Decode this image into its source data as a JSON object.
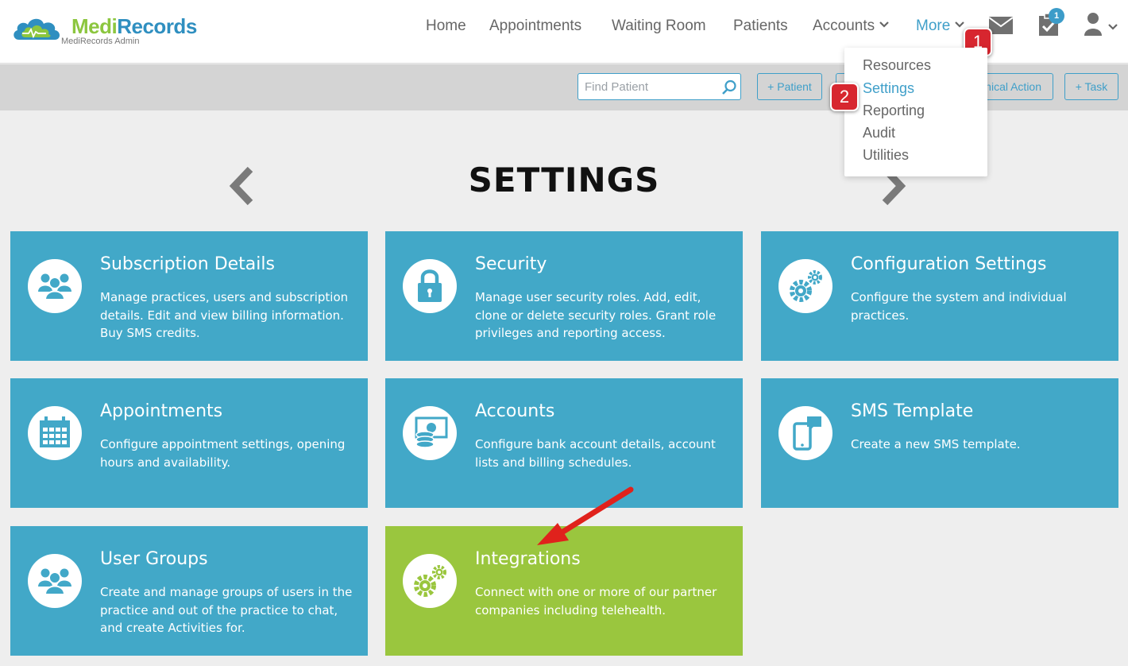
{
  "brand": {
    "name_part1": "Medi",
    "name_part2": "Records",
    "subtitle": "MediRecords Admin",
    "colors": {
      "green": "#8cc63f",
      "blue": "#2f8fc0"
    }
  },
  "nav": {
    "items": [
      {
        "label": "Home"
      },
      {
        "label": "Appointments"
      },
      {
        "label": "Waiting Room"
      },
      {
        "label": "Patients"
      },
      {
        "label": "Accounts"
      },
      {
        "label": "More"
      }
    ],
    "active": "More",
    "icons": [
      "mail-icon",
      "tasks-icon",
      "user-icon"
    ],
    "tasks_badge": "1"
  },
  "callouts": [
    "1",
    "2"
  ],
  "toolbar": {
    "search_placeholder": "Find Patient",
    "add_patient": "+ Patient",
    "clinical_action": "Clinical Action",
    "add_task": "+ Task"
  },
  "more_menu": {
    "items": [
      "Resources",
      "Settings",
      "Reporting",
      "Audit",
      "Utilities"
    ],
    "selected": "Settings"
  },
  "page": {
    "title": "SETTINGS"
  },
  "tiles": [
    {
      "title": "Subscription Details",
      "desc": "Manage practices, users and subscription details. Edit and view billing information. Buy SMS credits.",
      "icon": "users-icon"
    },
    {
      "title": "Security",
      "desc": "Manage user security roles. Add, edit, clone or delete security roles. Grant role privileges and reporting access.",
      "icon": "lock-icon"
    },
    {
      "title": "Configuration Settings",
      "desc": "Configure the system and individual practices.",
      "icon": "gears-icon"
    },
    {
      "title": "Appointments",
      "desc": "Configure appointment settings, opening hours and availability.",
      "icon": "calendar-icon"
    },
    {
      "title": "Accounts",
      "desc": "Configure bank account details, account lists and billing schedules.",
      "icon": "money-icon"
    },
    {
      "title": "SMS Template",
      "desc": "Create a new SMS template.",
      "icon": "phone-chat-icon"
    },
    {
      "title": "User Groups",
      "desc": "Create and manage groups of users in the practice and out of the practice to chat, and create Activities for.",
      "icon": "users-icon"
    },
    {
      "title": "Integrations",
      "desc": "Connect with one or more of our partner companies including telehealth.",
      "icon": "gears-icon",
      "highlighted": true
    }
  ],
  "colors": {
    "tile": "#42a8c8",
    "tile_highlight": "#9ac63e",
    "accent": "#3f9fc9",
    "callout": "#d7262f"
  }
}
